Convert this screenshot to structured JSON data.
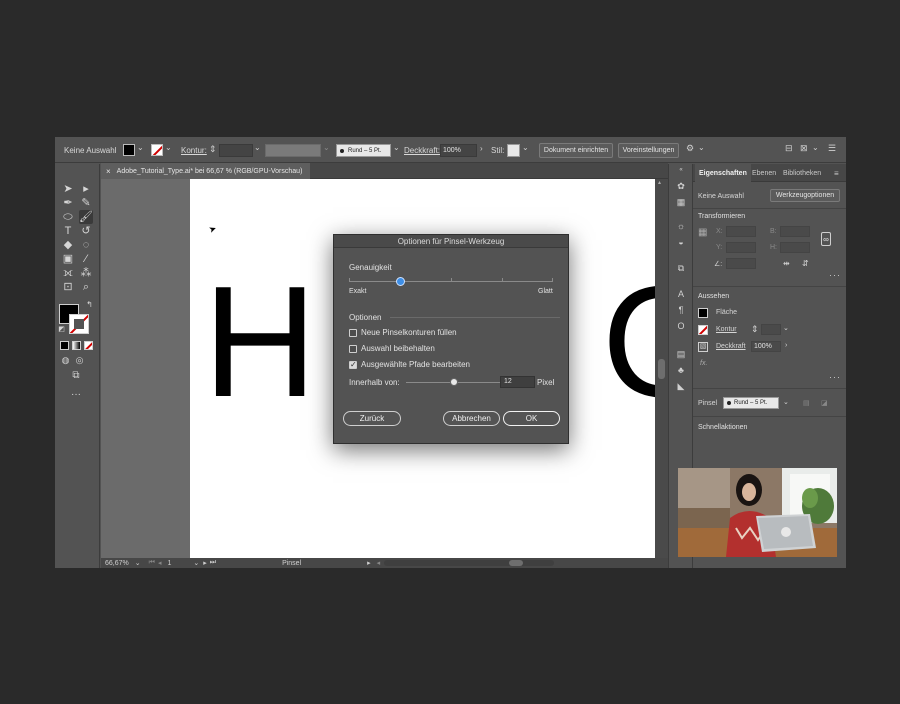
{
  "control_bar": {
    "selection_state": "Keine Auswahl",
    "stroke_label": "Kontur:",
    "brush_value": "Rund – 5 Pt.",
    "opacity_label": "Deckkraft:",
    "opacity_value": "100%",
    "style_label": "Stil:",
    "document_setup_button": "Dokument einrichten",
    "preferences_button": "Voreinstellungen"
  },
  "document": {
    "tab_title": "Adobe_Tutorial_Type.ai* bei 66,67 % (RGB/GPU-Vorschau)",
    "letters": [
      "H",
      "O"
    ]
  },
  "status_bar": {
    "zoom": "66,67%",
    "artboard_number": "1",
    "current_tool": "Pinsel"
  },
  "properties_panel": {
    "tabs": [
      {
        "label": "Eigenschaften",
        "active": true
      },
      {
        "label": "Ebenen",
        "active": false
      },
      {
        "label": "Bibliotheken",
        "active": false
      }
    ],
    "selection_state": "Keine Auswahl",
    "tool_options_button": "Werkzeugoptionen",
    "transform_header": "Transformieren",
    "x_label": "X:",
    "y_label": "Y:",
    "b_label": "B:",
    "h_label": "H:",
    "angle_label": "∠:",
    "appearance_header": "Aussehen",
    "fill_label": "Fläche",
    "stroke_label": "Kontur",
    "opacity_label": "Deckkraft",
    "opacity_value": "100%",
    "fx_label": "fx.",
    "brush_label": "Pinsel",
    "brush_value": "Rund – 5 Pt.",
    "quick_actions_header": "Schnellaktionen"
  },
  "dialog": {
    "title": "Optionen für Pinsel-Werkzeug",
    "accuracy_label": "Genauigkeit",
    "accuracy_min_label": "Exakt",
    "accuracy_max_label": "Glatt",
    "accuracy_fraction": 0.25,
    "options_label": "Optionen",
    "checkboxes": [
      {
        "label": "Neue Pinselkonturen füllen",
        "checked": false
      },
      {
        "label": "Auswahl beibehalten",
        "checked": false
      },
      {
        "label": "Ausgewählte Pfade bearbeiten",
        "checked": true
      }
    ],
    "within_label": "Innerhalb von:",
    "within_value": "12",
    "within_unit": "Pixel",
    "within_fraction": 0.5,
    "back_button": "Zurück",
    "cancel_button": "Abbrechen",
    "ok_button": "OK"
  },
  "colors": {
    "ui_background": "#535353",
    "outer_background": "#2a2a2a",
    "slider_knob": "#3d8ee6",
    "no_color_red": "#d10000"
  }
}
